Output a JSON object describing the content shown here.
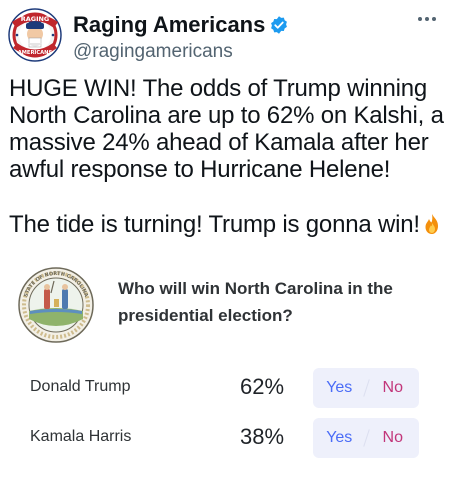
{
  "tweet": {
    "display_name": "Raging Americans",
    "handle": "@ragingamericans",
    "avatar_text_top": "RAGING",
    "avatar_text_bottom": "AMERICANS",
    "text": "HUGE WIN! The odds of Trump winning North Carolina are up to 62% on Kalshi, a massive 24% ahead of Kamala after her awful response to Hurricane Helene!",
    "text_2": "The tide is turning! Trump is gonna win!",
    "icons": {
      "verified": "verified-badge-icon",
      "more": "more-icon",
      "emoji": "fire-icon"
    },
    "colors": {
      "verified": "#1d9bf0",
      "secondary_text": "#536471"
    }
  },
  "market": {
    "seal_text": "STATE OF NORTH CAROLINA",
    "question": "Who will win North Carolina in the presidential election?",
    "candidates": [
      {
        "name": "Donald Trump",
        "odds": "62%",
        "yes_label": "Yes",
        "no_label": "No"
      },
      {
        "name": "Kamala Harris",
        "odds": "38%",
        "yes_label": "Yes",
        "no_label": "No"
      }
    ],
    "colors": {
      "yes": "#4a6cf7",
      "no": "#c2367a",
      "button_bg": "#eef0fb"
    }
  }
}
